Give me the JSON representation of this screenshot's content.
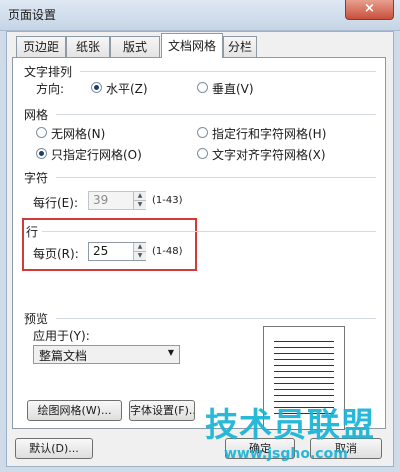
{
  "window": {
    "title": "页面设置",
    "close_glyph": "×"
  },
  "tabs": [
    {
      "label": "页边距"
    },
    {
      "label": "纸张"
    },
    {
      "label": "版式"
    },
    {
      "label": "文档网格",
      "active": true
    },
    {
      "label": "分栏"
    }
  ],
  "text_direction": {
    "section": "文字排列",
    "direction_label": "方向:",
    "horizontal": "水平(Z)",
    "vertical": "垂直(V)",
    "selected": "horizontal"
  },
  "grid": {
    "section": "网格",
    "no_grid": "无网格(N)",
    "line_and_char": "指定行和字符网格(H)",
    "line_only": "只指定行网格(O)",
    "char_align": "文字对齐字符网格(X)",
    "selected": "line_only"
  },
  "characters": {
    "section": "字符",
    "per_line_label": "每行(E):",
    "per_line_value": "39",
    "range": "(1-43)"
  },
  "lines": {
    "section": "行",
    "per_page_label": "每页(R):",
    "per_page_value": "25",
    "range": "(1-48)"
  },
  "preview": {
    "section": "预览",
    "apply_label": "应用于(Y):",
    "apply_value": "整篇文档"
  },
  "buttons": {
    "drawing_grid": "绘图网格(W)...",
    "font_settings": "字体设置(F)...",
    "default": "默认(D)...",
    "ok": "确定",
    "cancel": "取消"
  },
  "watermark": {
    "text": "技术员联盟",
    "url": "www.jsgho.com"
  },
  "colors": {
    "highlight_box": "#d03a3a",
    "watermark": "#19b4d6"
  }
}
